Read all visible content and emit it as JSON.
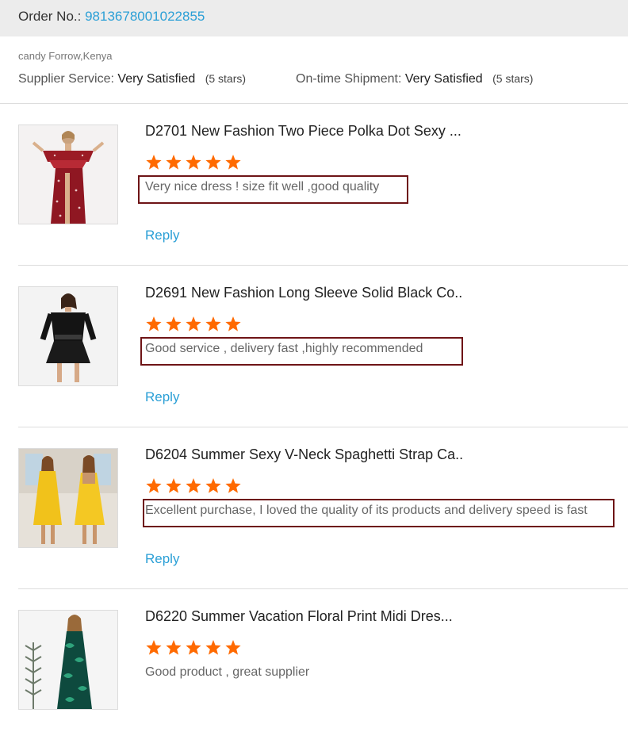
{
  "order": {
    "label": "Order No.:",
    "number": "9813678001022855"
  },
  "buyer": "candy Forrow,Kenya",
  "supplier_service": {
    "label": "Supplier Service:",
    "value": "Very Satisfied",
    "note": "(5 stars)"
  },
  "shipment": {
    "label": "On-time Shipment:",
    "value": "Very Satisfied",
    "note": "(5 stars)"
  },
  "colors": {
    "accent": "#2a9fd6",
    "star": "#ff6a00",
    "highlight_border": "#6e1416"
  },
  "reviews": [
    {
      "title": "D2701 New Fashion Two Piece Polka Dot Sexy ...",
      "rating": 5,
      "comment": "Very nice dress ! size fit well ,good quality",
      "reply": "Reply",
      "highlighted": true,
      "image": "red-polka-dot-two-piece-dress"
    },
    {
      "title": "D2691 New Fashion Long Sleeve Solid Black Co..",
      "rating": 5,
      "comment": "Good service , delivery fast ,highly recommended",
      "reply": "Reply",
      "highlighted": true,
      "image": "black-off-shoulder-dress"
    },
    {
      "title": "D6204 Summer Sexy V-Neck Spaghetti Strap Ca..",
      "rating": 5,
      "comment": "Excellent purchase, I loved the quality of its products and delivery speed is fast",
      "reply": "Reply",
      "highlighted": true,
      "image": "yellow-spaghetti-strap-dress"
    },
    {
      "title": "D6220 Summer Vacation Floral Print Midi Dres...",
      "rating": 5,
      "comment": "Good product , great supplier",
      "reply": "",
      "highlighted": false,
      "image": "green-floral-midi-dress"
    }
  ]
}
